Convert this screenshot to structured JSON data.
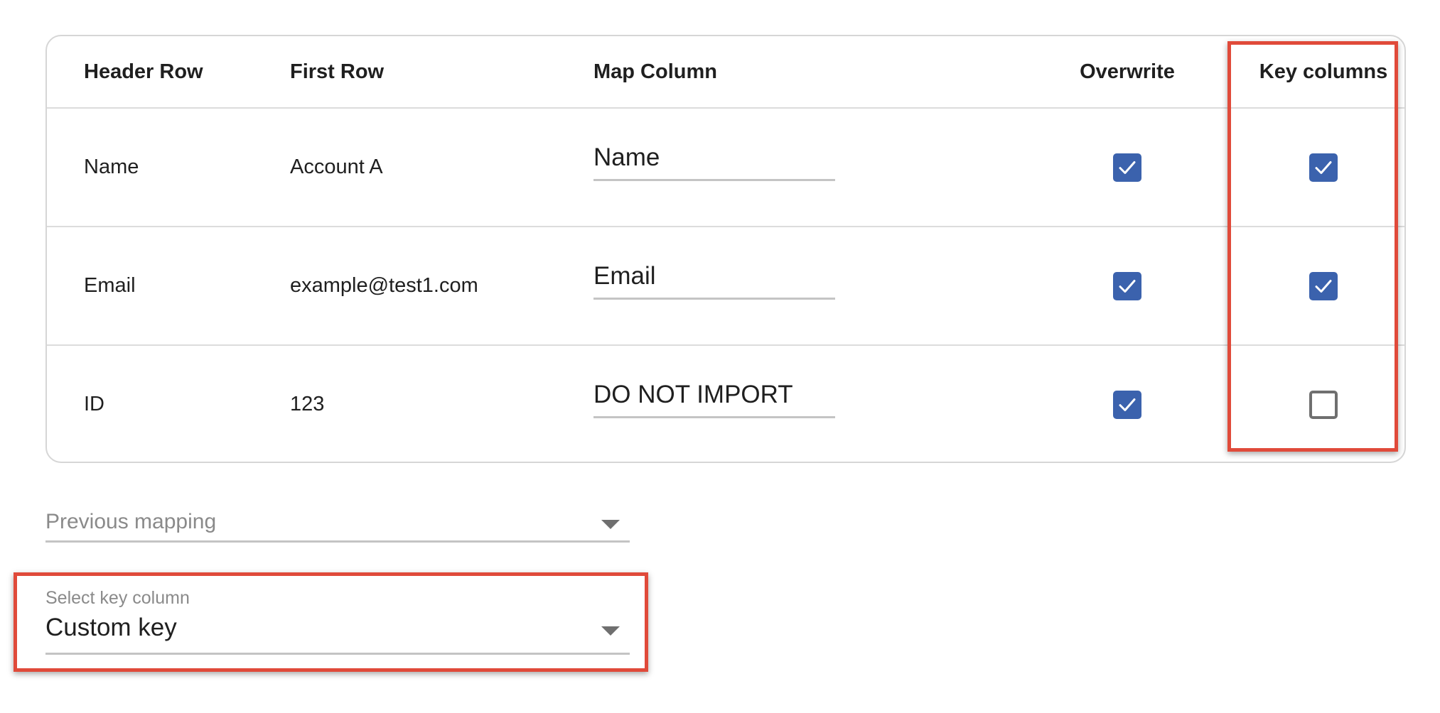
{
  "table": {
    "headers": {
      "header_row": "Header Row",
      "first_row": "First Row",
      "map_column": "Map Column",
      "overwrite": "Overwrite",
      "key_columns": "Key columns"
    },
    "rows": [
      {
        "header": "Name",
        "first": "Account A",
        "map": "Name",
        "overwrite": true,
        "key": true
      },
      {
        "header": "Email",
        "first": "example@test1.com",
        "map": "Email",
        "overwrite": true,
        "key": true
      },
      {
        "header": "ID",
        "first": "123",
        "map": "DO NOT IMPORT",
        "overwrite": true,
        "key": false
      }
    ]
  },
  "previous_mapping": {
    "placeholder": "Previous mapping",
    "icon": "chevron-down-icon"
  },
  "key_column_select": {
    "label": "Select key column",
    "value": "Custom key",
    "icon": "chevron-down-icon"
  },
  "colors": {
    "checkbox_checked": "#3b62ad",
    "highlight": "#e04a3a"
  }
}
